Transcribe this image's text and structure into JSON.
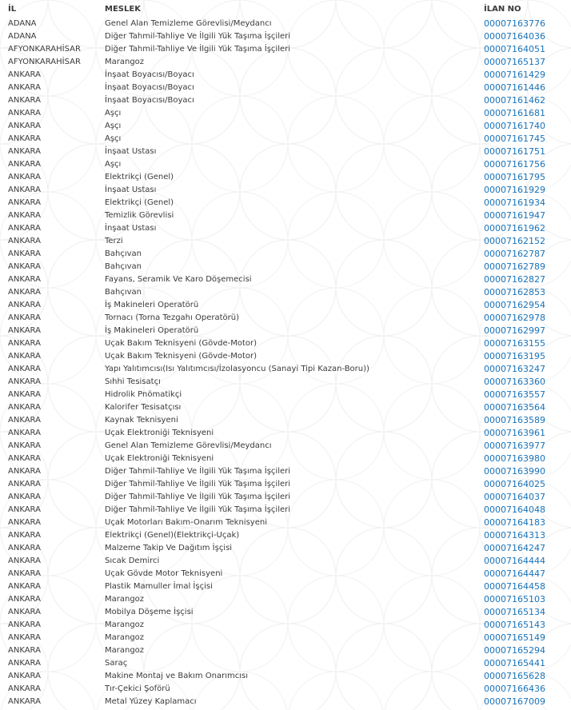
{
  "table": {
    "headers": {
      "il": "İL",
      "meslek": "MESLEK",
      "ilan_no": "İLAN NO"
    },
    "rows": [
      {
        "il": "ADANA",
        "meslek": "Genel Alan Temizleme Görevlisi/Meydancı",
        "ilan_no": "00007163776"
      },
      {
        "il": "ADANA",
        "meslek": "Diğer Tahmil-Tahliye Ve İlgili Yük Taşıma İşçileri",
        "ilan_no": "00007164036"
      },
      {
        "il": "AFYONKARAHİSAR",
        "meslek": "Diğer Tahmil-Tahliye Ve İlgili Yük Taşıma İşçileri",
        "ilan_no": "00007164051"
      },
      {
        "il": "AFYONKARAHİSAR",
        "meslek": "Marangoz",
        "ilan_no": "00007165137"
      },
      {
        "il": "ANKARA",
        "meslek": "İnşaat Boyacısı/Boyacı",
        "ilan_no": "00007161429"
      },
      {
        "il": "ANKARA",
        "meslek": "İnşaat Boyacısı/Boyacı",
        "ilan_no": "00007161446"
      },
      {
        "il": "ANKARA",
        "meslek": "İnşaat Boyacısı/Boyacı",
        "ilan_no": "00007161462"
      },
      {
        "il": "ANKARA",
        "meslek": "Aşçı",
        "ilan_no": "00007161681"
      },
      {
        "il": "ANKARA",
        "meslek": "Aşçı",
        "ilan_no": "00007161740"
      },
      {
        "il": "ANKARA",
        "meslek": "Aşçı",
        "ilan_no": "00007161745"
      },
      {
        "il": "ANKARA",
        "meslek": "İnşaat Ustası",
        "ilan_no": "00007161751"
      },
      {
        "il": "ANKARA",
        "meslek": "Aşçı",
        "ilan_no": "00007161756"
      },
      {
        "il": "ANKARA",
        "meslek": "Elektrikçi (Genel)",
        "ilan_no": "00007161795"
      },
      {
        "il": "ANKARA",
        "meslek": "İnşaat Ustası",
        "ilan_no": "00007161929"
      },
      {
        "il": "ANKARA",
        "meslek": "Elektrikçi (Genel)",
        "ilan_no": "00007161934"
      },
      {
        "il": "ANKARA",
        "meslek": "Temizlik Görevlisi",
        "ilan_no": "00007161947"
      },
      {
        "il": "ANKARA",
        "meslek": "İnşaat Ustası",
        "ilan_no": "00007161962"
      },
      {
        "il": "ANKARA",
        "meslek": "Terzi",
        "ilan_no": "00007162152"
      },
      {
        "il": "ANKARA",
        "meslek": "Bahçıvan",
        "ilan_no": "00007162787"
      },
      {
        "il": "ANKARA",
        "meslek": "Bahçıvan",
        "ilan_no": "00007162789"
      },
      {
        "il": "ANKARA",
        "meslek": "Fayans, Seramik Ve Karo Döşemecisi",
        "ilan_no": "00007162827"
      },
      {
        "il": "ANKARA",
        "meslek": "Bahçıvan",
        "ilan_no": "00007162853"
      },
      {
        "il": "ANKARA",
        "meslek": "İş Makineleri Operatörü",
        "ilan_no": "00007162954"
      },
      {
        "il": "ANKARA",
        "meslek": "Tornacı (Torna Tezgahı Operatörü)",
        "ilan_no": "00007162978"
      },
      {
        "il": "ANKARA",
        "meslek": "İş Makineleri Operatörü",
        "ilan_no": "00007162997"
      },
      {
        "il": "ANKARA",
        "meslek": "Uçak Bakım Teknisyeni (Gövde-Motor)",
        "ilan_no": "00007163155"
      },
      {
        "il": "ANKARA",
        "meslek": "Uçak Bakım Teknisyeni (Gövde-Motor)",
        "ilan_no": "00007163195"
      },
      {
        "il": "ANKARA",
        "meslek": "Yapı Yalıtımcısı(Isı Yalıtımcısı/İzolasyoncu (Sanayi Tipi Kazan-Boru))",
        "ilan_no": "00007163247"
      },
      {
        "il": "ANKARA",
        "meslek": "Sıhhi Tesisatçı",
        "ilan_no": "00007163360"
      },
      {
        "il": "ANKARA",
        "meslek": "Hidrolik Pnömatikçi",
        "ilan_no": "00007163557"
      },
      {
        "il": "ANKARA",
        "meslek": "Kalorifer Tesisatçısı",
        "ilan_no": "00007163564"
      },
      {
        "il": "ANKARA",
        "meslek": "Kaynak Teknisyeni",
        "ilan_no": "00007163589"
      },
      {
        "il": "ANKARA",
        "meslek": "Uçak Elektroniği Teknisyeni",
        "ilan_no": "00007163961"
      },
      {
        "il": "ANKARA",
        "meslek": "Genel Alan Temizleme Görevlisi/Meydancı",
        "ilan_no": "00007163977"
      },
      {
        "il": "ANKARA",
        "meslek": "Uçak Elektroniği Teknisyeni",
        "ilan_no": "00007163980"
      },
      {
        "il": "ANKARA",
        "meslek": "Diğer Tahmil-Tahliye Ve İlgili Yük Taşıma İşçileri",
        "ilan_no": "00007163990"
      },
      {
        "il": "ANKARA",
        "meslek": "Diğer Tahmil-Tahliye Ve İlgili Yük Taşıma İşçileri",
        "ilan_no": "00007164025"
      },
      {
        "il": "ANKARA",
        "meslek": "Diğer Tahmil-Tahliye Ve İlgili Yük Taşıma İşçileri",
        "ilan_no": "00007164037"
      },
      {
        "il": "ANKARA",
        "meslek": "Diğer Tahmil-Tahliye Ve İlgili Yük Taşıma İşçileri",
        "ilan_no": "00007164048"
      },
      {
        "il": "ANKARA",
        "meslek": "Uçak Motorları Bakım-Onarım Teknisyeni",
        "ilan_no": "00007164183"
      },
      {
        "il": "ANKARA",
        "meslek": "Elektrikçi (Genel)(Elektrikçi-Uçak)",
        "ilan_no": "00007164313"
      },
      {
        "il": "ANKARA",
        "meslek": "Malzeme Takip Ve Dağıtım İşçisi",
        "ilan_no": "00007164247"
      },
      {
        "il": "ANKARA",
        "meslek": "Sıcak Demirci",
        "ilan_no": "00007164444"
      },
      {
        "il": "ANKARA",
        "meslek": "Uçak Gövde Motor Teknisyeni",
        "ilan_no": "00007164447"
      },
      {
        "il": "ANKARA",
        "meslek": "Plastik Mamuller İmal İşçisi",
        "ilan_no": "00007164458"
      },
      {
        "il": "ANKARA",
        "meslek": "Marangoz",
        "ilan_no": "00007165103"
      },
      {
        "il": "ANKARA",
        "meslek": "Mobilya Döşeme İşçisi",
        "ilan_no": "00007165134"
      },
      {
        "il": "ANKARA",
        "meslek": "Marangoz",
        "ilan_no": "00007165143"
      },
      {
        "il": "ANKARA",
        "meslek": "Marangoz",
        "ilan_no": "00007165149"
      },
      {
        "il": "ANKARA",
        "meslek": "Marangoz",
        "ilan_no": "00007165294"
      },
      {
        "il": "ANKARA",
        "meslek": "Saraç",
        "ilan_no": "00007165441"
      },
      {
        "il": "ANKARA",
        "meslek": "Makine Montaj ve Bakım Onarımcısı",
        "ilan_no": "00007165628"
      },
      {
        "il": "ANKARA",
        "meslek": "Tır-Çekici Şoförü",
        "ilan_no": "00007166436"
      },
      {
        "il": "ANKARA",
        "meslek": "Metal Yüzey Kaplamacı",
        "ilan_no": "00007167009"
      }
    ]
  },
  "colors": {
    "text": "#3a3a3a",
    "link": "#1a73b8",
    "pattern": "#eeeeee"
  }
}
